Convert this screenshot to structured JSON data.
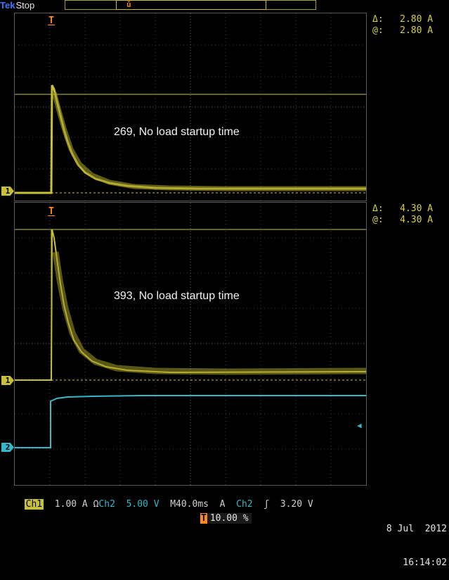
{
  "header": {
    "brand": "Tek",
    "status": "Stop"
  },
  "trigger_marker": "T",
  "panels": [
    {
      "label": "269, No load startup time",
      "cursor_delta": "Δ:   2.80 A",
      "cursor_at": "@:   2.80 A",
      "channel_marker": "1"
    },
    {
      "label": "393, No load startup time",
      "cursor_delta": "Δ:   4.30 A",
      "cursor_at": "@:   4.30 A",
      "channel_marker": "1",
      "channel2_marker": "2"
    }
  ],
  "bottom_bar": {
    "ch1_label": "Ch1",
    "ch1_scale": "1.00 A Ω",
    "ch2_label": "Ch2",
    "ch2_scale": "5.00 V",
    "timebase": "M40.0ms",
    "trigger_source_prefix": "A",
    "trigger_source": "Ch2",
    "trigger_slope": "ʃ",
    "trigger_level": "3.20 V"
  },
  "date": "8 Jul  2012",
  "time": "16:14:02",
  "trigger_position": "10.00 %",
  "colors": {
    "ch1": "#c8c03a",
    "ch2": "#36b8c8",
    "trigger": "#ff8a1c",
    "grid": "#5a5a5a"
  }
}
